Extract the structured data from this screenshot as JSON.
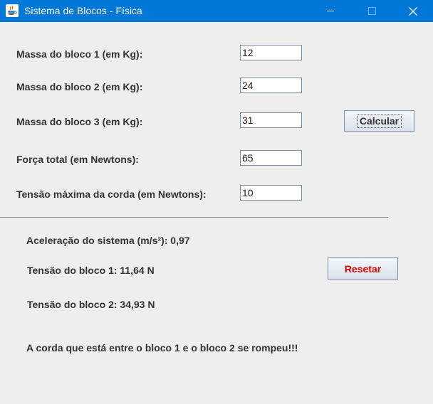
{
  "window": {
    "title": "Sistema de Blocos - Física"
  },
  "form": {
    "mass1": {
      "label": "Massa do bloco 1 (em Kg):",
      "value": "12"
    },
    "mass2": {
      "label": "Massa do bloco 2 (em Kg):",
      "value": "24"
    },
    "mass3": {
      "label": "Massa do bloco 3 (em Kg):",
      "value": "31"
    },
    "force": {
      "label": "Força total (em Newtons):",
      "value": "65"
    },
    "max_tension": {
      "label": "Tensão máxima da corda (em Newtons):",
      "value": "10"
    },
    "calculate_label": "Calcular"
  },
  "results": {
    "acceleration": "Aceleração do sistema (m/s²): 0,97",
    "tension1": "Tensão do bloco 1: 11,64 N",
    "tension2": "Tensão do bloco 2: 34,93 N",
    "message": "A corda que está entre o bloco 1 e o bloco 2 se rompeu!!!",
    "reset_label": "Resetar"
  },
  "icons": {
    "app": "java-cup-icon",
    "minimize": "minimize-icon",
    "maximize": "maximize-icon",
    "close": "close-icon"
  },
  "colors": {
    "titlebar": "#0078d7",
    "background": "#eeeeee",
    "reset_text": "#e50000",
    "text": "#333333"
  }
}
